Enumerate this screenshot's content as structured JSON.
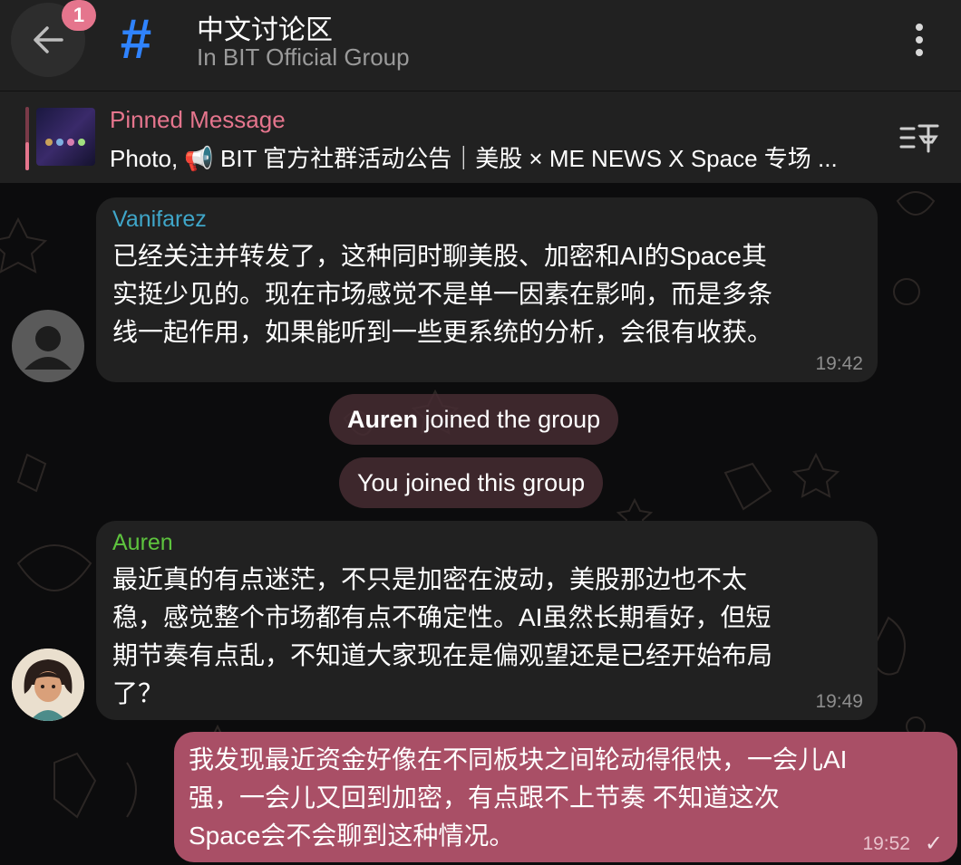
{
  "header": {
    "back_badge": "1",
    "title": "中文讨论区",
    "subtitle": "In BIT Official Group"
  },
  "pinned": {
    "label": "Pinned Message",
    "text": "Photo, 📢 BIT 官方社群活动公告｜美股 × ME NEWS X Space 专场 ..."
  },
  "messages": [
    {
      "sender": "Vanifarez",
      "sender_color": "#3fa6c9",
      "text": "已经关注并转发了，这种同时聊美股、加密和AI的Space其\n实挺少见的。现在市场感觉不是单一因素在影响，而是多条\n线一起作用，如果能听到一些更系统的分析，会很有收获。",
      "time": "19:42"
    },
    {
      "service_name": "Auren",
      "service_rest": " joined the group"
    },
    {
      "service_text": "You joined this group"
    },
    {
      "sender": "Auren",
      "sender_color": "#5ec43e",
      "text": "最近真的有点迷茫，不只是加密在波动，美股那边也不太\n稳，感觉整个市场都有点不确定性。AI虽然长期看好，但短\n期节奏有点乱，不知道大家现在是偏观望还是已经开始布局\n了？",
      "time": "19:49"
    },
    {
      "text": "我发现最近资金好像在不同板块之间轮动得很快，一会儿AI\n强，一会儿又回到加密，有点跟不上节奏  不知道这次\nSpace会不会聊到这种情况。",
      "time": "19:52",
      "status": "✓"
    }
  ],
  "colors": {
    "accent": "#e5758d",
    "outgoing_bubble": "#a94f66",
    "incoming_bubble": "#212121",
    "channel_icon": "#2f83ff"
  }
}
